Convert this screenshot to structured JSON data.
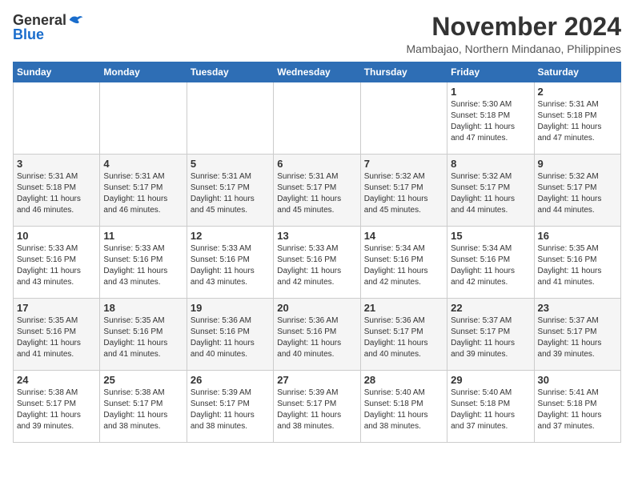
{
  "header": {
    "logo_general": "General",
    "logo_blue": "Blue",
    "month_title": "November 2024",
    "location": "Mambajao, Northern Mindanao, Philippines"
  },
  "weekdays": [
    "Sunday",
    "Monday",
    "Tuesday",
    "Wednesday",
    "Thursday",
    "Friday",
    "Saturday"
  ],
  "weeks": [
    [
      {
        "day": "",
        "info": ""
      },
      {
        "day": "",
        "info": ""
      },
      {
        "day": "",
        "info": ""
      },
      {
        "day": "",
        "info": ""
      },
      {
        "day": "",
        "info": ""
      },
      {
        "day": "1",
        "info": "Sunrise: 5:30 AM\nSunset: 5:18 PM\nDaylight: 11 hours\nand 47 minutes."
      },
      {
        "day": "2",
        "info": "Sunrise: 5:31 AM\nSunset: 5:18 PM\nDaylight: 11 hours\nand 47 minutes."
      }
    ],
    [
      {
        "day": "3",
        "info": "Sunrise: 5:31 AM\nSunset: 5:18 PM\nDaylight: 11 hours\nand 46 minutes."
      },
      {
        "day": "4",
        "info": "Sunrise: 5:31 AM\nSunset: 5:17 PM\nDaylight: 11 hours\nand 46 minutes."
      },
      {
        "day": "5",
        "info": "Sunrise: 5:31 AM\nSunset: 5:17 PM\nDaylight: 11 hours\nand 45 minutes."
      },
      {
        "day": "6",
        "info": "Sunrise: 5:31 AM\nSunset: 5:17 PM\nDaylight: 11 hours\nand 45 minutes."
      },
      {
        "day": "7",
        "info": "Sunrise: 5:32 AM\nSunset: 5:17 PM\nDaylight: 11 hours\nand 45 minutes."
      },
      {
        "day": "8",
        "info": "Sunrise: 5:32 AM\nSunset: 5:17 PM\nDaylight: 11 hours\nand 44 minutes."
      },
      {
        "day": "9",
        "info": "Sunrise: 5:32 AM\nSunset: 5:17 PM\nDaylight: 11 hours\nand 44 minutes."
      }
    ],
    [
      {
        "day": "10",
        "info": "Sunrise: 5:33 AM\nSunset: 5:16 PM\nDaylight: 11 hours\nand 43 minutes."
      },
      {
        "day": "11",
        "info": "Sunrise: 5:33 AM\nSunset: 5:16 PM\nDaylight: 11 hours\nand 43 minutes."
      },
      {
        "day": "12",
        "info": "Sunrise: 5:33 AM\nSunset: 5:16 PM\nDaylight: 11 hours\nand 43 minutes."
      },
      {
        "day": "13",
        "info": "Sunrise: 5:33 AM\nSunset: 5:16 PM\nDaylight: 11 hours\nand 42 minutes."
      },
      {
        "day": "14",
        "info": "Sunrise: 5:34 AM\nSunset: 5:16 PM\nDaylight: 11 hours\nand 42 minutes."
      },
      {
        "day": "15",
        "info": "Sunrise: 5:34 AM\nSunset: 5:16 PM\nDaylight: 11 hours\nand 42 minutes."
      },
      {
        "day": "16",
        "info": "Sunrise: 5:35 AM\nSunset: 5:16 PM\nDaylight: 11 hours\nand 41 minutes."
      }
    ],
    [
      {
        "day": "17",
        "info": "Sunrise: 5:35 AM\nSunset: 5:16 PM\nDaylight: 11 hours\nand 41 minutes."
      },
      {
        "day": "18",
        "info": "Sunrise: 5:35 AM\nSunset: 5:16 PM\nDaylight: 11 hours\nand 41 minutes."
      },
      {
        "day": "19",
        "info": "Sunrise: 5:36 AM\nSunset: 5:16 PM\nDaylight: 11 hours\nand 40 minutes."
      },
      {
        "day": "20",
        "info": "Sunrise: 5:36 AM\nSunset: 5:16 PM\nDaylight: 11 hours\nand 40 minutes."
      },
      {
        "day": "21",
        "info": "Sunrise: 5:36 AM\nSunset: 5:17 PM\nDaylight: 11 hours\nand 40 minutes."
      },
      {
        "day": "22",
        "info": "Sunrise: 5:37 AM\nSunset: 5:17 PM\nDaylight: 11 hours\nand 39 minutes."
      },
      {
        "day": "23",
        "info": "Sunrise: 5:37 AM\nSunset: 5:17 PM\nDaylight: 11 hours\nand 39 minutes."
      }
    ],
    [
      {
        "day": "24",
        "info": "Sunrise: 5:38 AM\nSunset: 5:17 PM\nDaylight: 11 hours\nand 39 minutes."
      },
      {
        "day": "25",
        "info": "Sunrise: 5:38 AM\nSunset: 5:17 PM\nDaylight: 11 hours\nand 38 minutes."
      },
      {
        "day": "26",
        "info": "Sunrise: 5:39 AM\nSunset: 5:17 PM\nDaylight: 11 hours\nand 38 minutes."
      },
      {
        "day": "27",
        "info": "Sunrise: 5:39 AM\nSunset: 5:17 PM\nDaylight: 11 hours\nand 38 minutes."
      },
      {
        "day": "28",
        "info": "Sunrise: 5:40 AM\nSunset: 5:18 PM\nDaylight: 11 hours\nand 38 minutes."
      },
      {
        "day": "29",
        "info": "Sunrise: 5:40 AM\nSunset: 5:18 PM\nDaylight: 11 hours\nand 37 minutes."
      },
      {
        "day": "30",
        "info": "Sunrise: 5:41 AM\nSunset: 5:18 PM\nDaylight: 11 hours\nand 37 minutes."
      }
    ]
  ]
}
